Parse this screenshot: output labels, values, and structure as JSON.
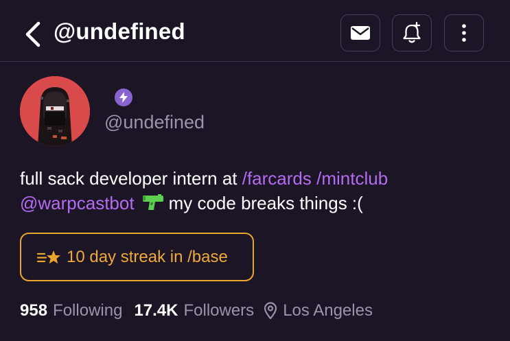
{
  "header": {
    "title": "@undefined",
    "icons": [
      "back-arrow-icon",
      "mail-icon",
      "bell-plus-icon",
      "more-vertical-icon"
    ]
  },
  "profile": {
    "avatar_colors": {
      "background": "#d94a4a"
    },
    "badge_icon": "lightning-bolt-icon",
    "badge_color": "#8a63d2",
    "username": "@undefined"
  },
  "bio": {
    "text_1": "full sack developer intern at ",
    "link_1": "/farcards",
    "link_2": "/mintclub",
    "link_3": "@warpcastbot",
    "emoji": "water-pistol-icon",
    "text_2": "my code breaks things :("
  },
  "streak": {
    "icon": "streak-star-icon",
    "label": "10 day streak in /base",
    "color": "#e9a62f"
  },
  "stats": {
    "following_count": "958",
    "following_label": "Following",
    "followers_count": "17.4K",
    "followers_label": "Followers",
    "location_icon": "map-pin-icon",
    "location": "Los Angeles"
  },
  "colors": {
    "background": "#1c1526",
    "link": "#b46cf0",
    "muted": "#9c94a8"
  }
}
